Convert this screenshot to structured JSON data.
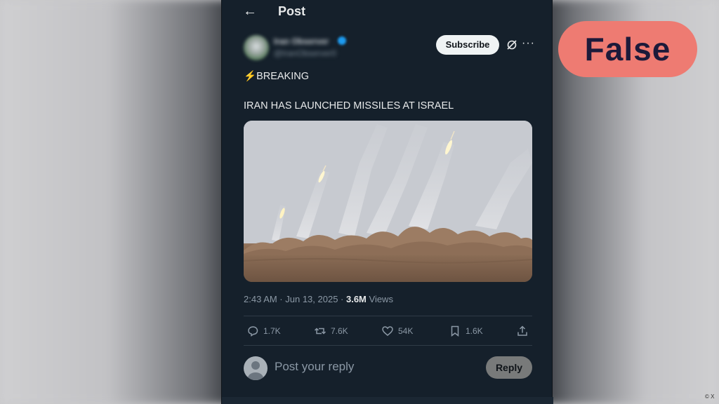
{
  "header": {
    "back_label": "←",
    "title": "Post"
  },
  "author": {
    "name": "Iran Observer",
    "handle": "@IranObserver0"
  },
  "actions_top": {
    "subscribe_label": "Subscribe"
  },
  "tweet": {
    "bolt": "⚡",
    "line1": "BREAKING",
    "line2": "IRAN HAS LAUNCHED MISSILES AT ISRAEL"
  },
  "meta": {
    "timestamp": "2:43 AM · Jun 13, 2025 · ",
    "views_count": "3.6M",
    "views_label": " Views"
  },
  "engagement": {
    "replies": "1.7K",
    "reposts": "7.6K",
    "likes": "54K",
    "bookmarks": "1.6K"
  },
  "reply": {
    "placeholder": "Post your reply",
    "button_label": "Reply"
  },
  "fact_check": {
    "verdict": "False",
    "color": "#ee7b72"
  },
  "credit": "© X",
  "colors": {
    "background": "#15202b",
    "accent": "#1d9bf0",
    "muted": "#8b98a5"
  }
}
